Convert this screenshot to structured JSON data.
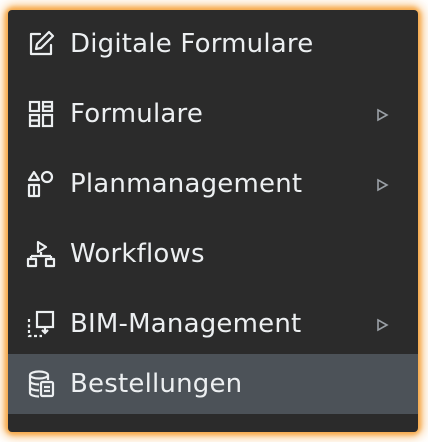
{
  "menu": {
    "items": [
      {
        "label": "Digitale Formulare",
        "icon": "edit-icon",
        "has_submenu": false,
        "active": false
      },
      {
        "label": "Formulare",
        "icon": "forms-grid-icon",
        "has_submenu": true,
        "active": false
      },
      {
        "label": "Planmanagement",
        "icon": "plan-icon",
        "has_submenu": true,
        "active": false
      },
      {
        "label": "Workflows",
        "icon": "workflow-icon",
        "has_submenu": false,
        "active": false
      },
      {
        "label": "BIM-Management",
        "icon": "bim-icon",
        "has_submenu": true,
        "active": false
      },
      {
        "label": "Bestellungen",
        "icon": "database-icon",
        "has_submenu": false,
        "active": true
      }
    ]
  },
  "colors": {
    "background": "#2b2b2b",
    "text": "#eceff1",
    "active_background": "#4c5258",
    "highlight_glow": "#f6a94a"
  }
}
